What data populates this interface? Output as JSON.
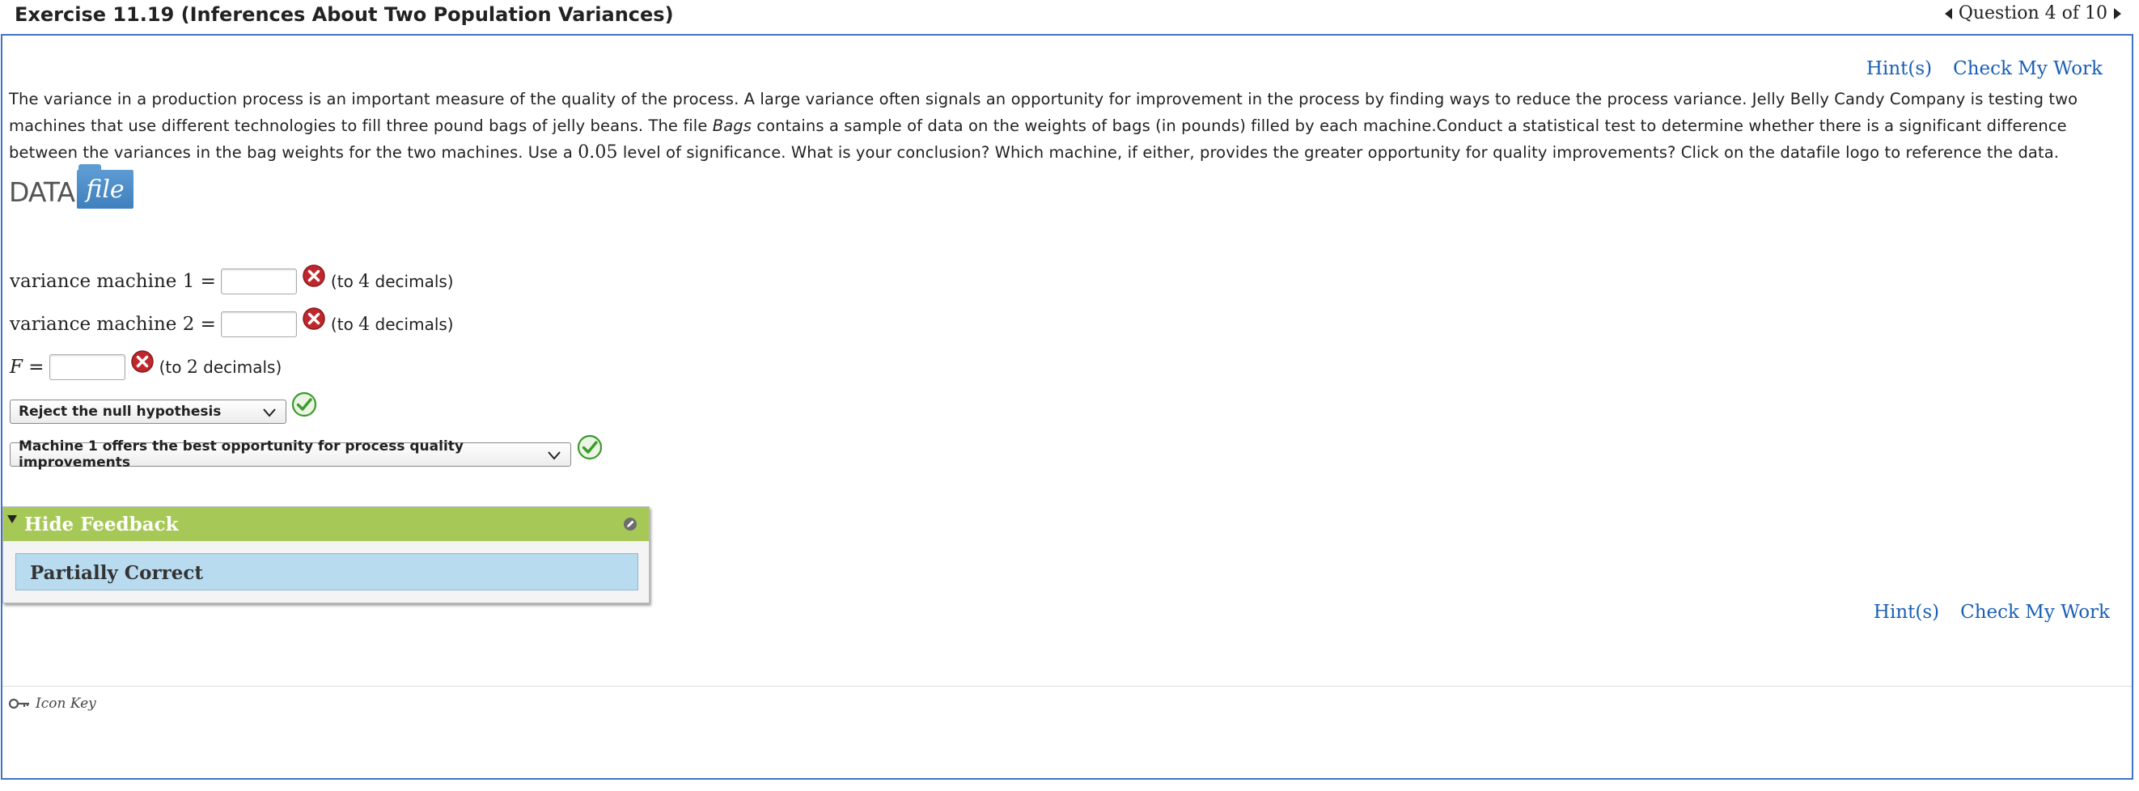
{
  "header": {
    "title": "Exercise 11.19 (Inferences About Two Population Variances)",
    "question_nav": "Question 4 of 10"
  },
  "links": {
    "hints": "Hint(s)",
    "check": "Check My Work"
  },
  "problem": {
    "p1": "The variance in a production process is an important measure of the quality of the process. A large variance often signals an opportunity for improvement in the process by finding ways to reduce the process variance. Jelly Belly Candy Company is testing two machines that use different technologies to fill three pound bags of jelly beans. The file ",
    "file_name": "Bags",
    "p2": " contains a sample of data on the weights of bags (in pounds) filled by each machine.Conduct a statistical test to determine whether there is a significant difference between the variances in the bag weights for the two machines. Use a ",
    "alpha": "0.05",
    "p3": " level of significance. What is your conclusion? Which machine, if either, provides the greater opportunity for quality improvements? Click on the datafile logo to reference the data."
  },
  "datafile": {
    "word1": "DATA",
    "word2": "file"
  },
  "answers": {
    "var1": {
      "label": "variance machine 1 =",
      "value": "",
      "hint_pre": "(to ",
      "hint_num": "4",
      "hint_post": " decimals)"
    },
    "var2": {
      "label": "variance machine 2 =",
      "value": "",
      "hint_pre": "(to ",
      "hint_num": "4",
      "hint_post": " decimals)"
    },
    "f": {
      "label_var": "F",
      "label_eq": " =",
      "value": "",
      "hint_pre": "(to ",
      "hint_num": "2",
      "hint_post": " decimals)"
    },
    "conclusion": {
      "selected": "Reject the null hypothesis"
    },
    "machine": {
      "selected": "Machine 1 offers the best opportunity for process quality improvements"
    }
  },
  "feedback": {
    "header": "Hide Feedback",
    "status": "Partially Correct"
  },
  "footer": {
    "icon_key": "Icon Key"
  },
  "colors": {
    "border_blue": "#3f73c7",
    "link_blue": "#1a5fb4",
    "feedback_green": "#a6c857",
    "feedback_blue": "#b9dbf0",
    "error_red": "#c0272d",
    "correct_green": "#3c9a2e"
  },
  "icons": {
    "incorrect": "x-circle-icon",
    "correct": "check-circle-icon",
    "dropdown": "chevron-down-icon",
    "key": "key-icon",
    "edit": "pencil-icon"
  }
}
